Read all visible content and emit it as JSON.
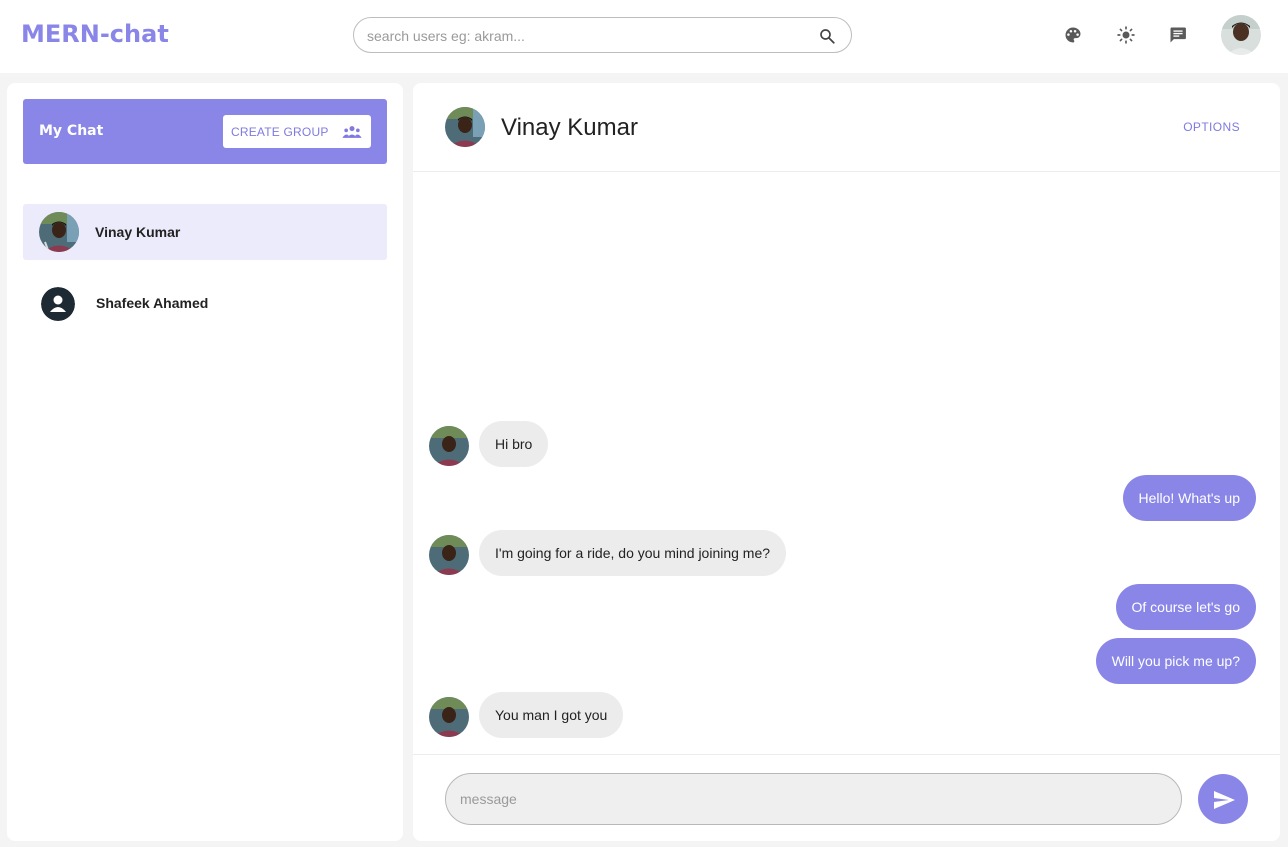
{
  "app": {
    "brand": "MERN-chat"
  },
  "header": {
    "search_placeholder": "search users eg: akram...",
    "icons": [
      "search-icon",
      "palette-icon",
      "brightness-icon",
      "chat-icon",
      "user-avatar"
    ]
  },
  "sidebar": {
    "title": "My Chat",
    "create_group_label": "CREATE GROUP",
    "chats": [
      {
        "name": "Vinay Kumar",
        "active": true,
        "avatar": "photo"
      },
      {
        "name": "Shafeek Ahamed",
        "active": false,
        "avatar": "default-user-icon"
      }
    ]
  },
  "chat": {
    "title": "Vinay Kumar",
    "options_label": "OPTIONS",
    "messages": [
      {
        "from": "them",
        "text": "Hi bro"
      },
      {
        "from": "me",
        "text": "Hello! What's up"
      },
      {
        "from": "them",
        "text": "I'm going for a ride, do you mind joining me?"
      },
      {
        "from": "me",
        "text": "Of course let's go"
      },
      {
        "from": "me",
        "text": "Will you pick me up?"
      },
      {
        "from": "them",
        "text": "You man I got you"
      }
    ],
    "composer_placeholder": "message"
  },
  "colors": {
    "accent": "#8a86e8",
    "active_item": "#ebebfb",
    "incoming_bubble": "#ececec",
    "background": "#f4f4f4"
  }
}
